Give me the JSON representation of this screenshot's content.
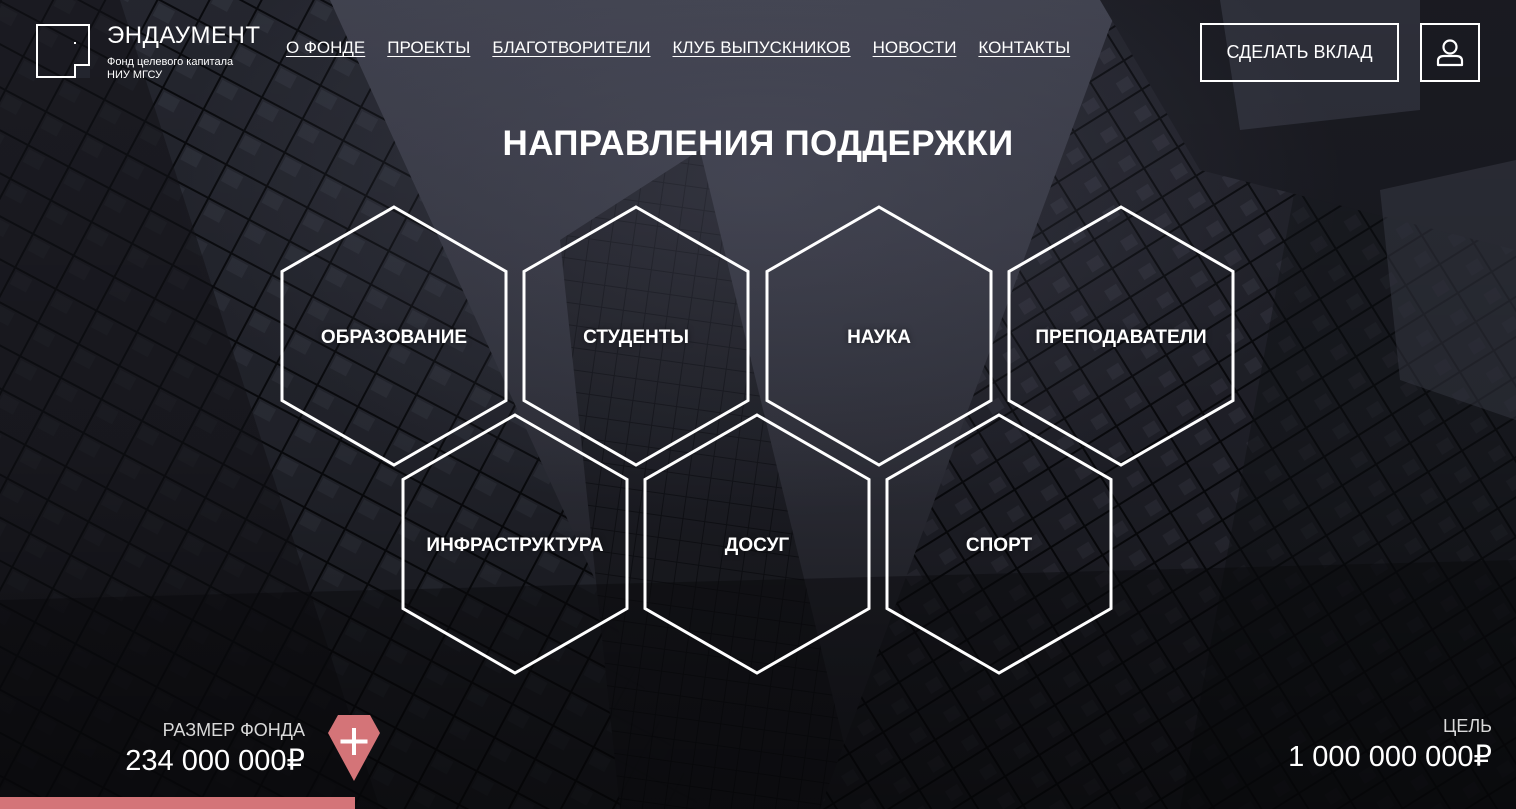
{
  "brand": {
    "title": "ЭНДАУМЕНТ",
    "subtitle_line1": "Фонд целевого капитала",
    "subtitle_line2": "НИУ МГСУ"
  },
  "nav": {
    "items": [
      {
        "label": "О ФОНДЕ"
      },
      {
        "label": "ПРОЕКТЫ"
      },
      {
        "label": "БЛАГОТВОРИТЕЛИ"
      },
      {
        "label": "КЛУБ ВЫПУСКНИКОВ"
      },
      {
        "label": "НОВОСТИ"
      },
      {
        "label": "КОНТАКТЫ"
      }
    ]
  },
  "header": {
    "cta_label": "СДЕЛАТЬ ВКЛАД",
    "user_icon": "user-icon"
  },
  "main": {
    "title": "НАПРАВЛЕНИЯ ПОДДЕРЖКИ",
    "directions": [
      {
        "label": "ОБРАЗОВАНИЕ"
      },
      {
        "label": "СТУДЕНТЫ"
      },
      {
        "label": "НАУКА"
      },
      {
        "label": "ПРЕПОДАВАТЕЛИ"
      },
      {
        "label": "ИНФРАСТРУКТУРА"
      },
      {
        "label": "ДОСУГ"
      },
      {
        "label": "СПОРТ"
      }
    ]
  },
  "fund": {
    "label": "РАЗМЕР ФОНДА",
    "value": "234 000 000₽",
    "goal_label": "ЦЕЛЬ",
    "goal_value": "1 000 000 000₽",
    "progress_fraction": 0.234,
    "plus_icon": "plus-icon"
  },
  "colors": {
    "accent": "#d47478",
    "text": "#ffffff",
    "background": "#1c1d24"
  }
}
